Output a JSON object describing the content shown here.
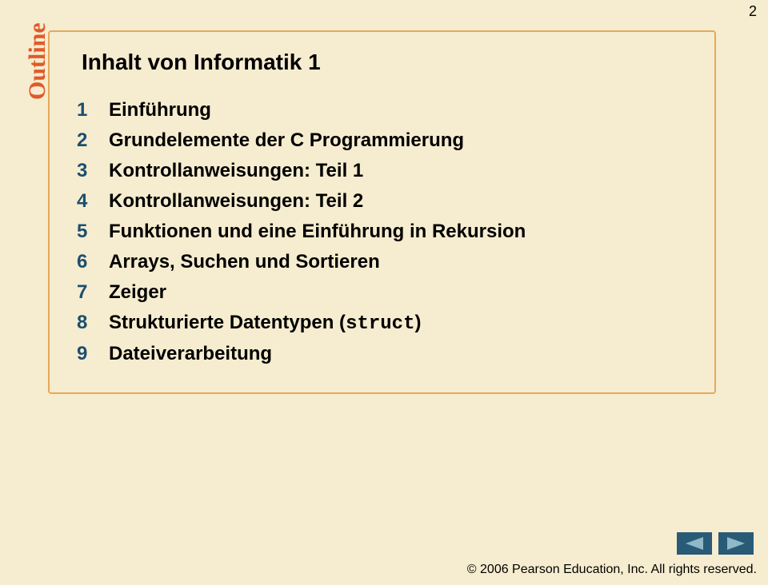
{
  "page_number": "2",
  "sidebar_label": "Outline",
  "title": "Inhalt von Informatik 1",
  "items": [
    {
      "num": "1",
      "text": "Einführung"
    },
    {
      "num": "2",
      "text": "Grundelemente der C Programmierung"
    },
    {
      "num": "3",
      "text": "Kontrollanweisungen: Teil 1"
    },
    {
      "num": "4",
      "text": "Kontrollanweisungen: Teil 2"
    },
    {
      "num": "5",
      "text": "Funktionen und eine Einführung in Rekursion"
    },
    {
      "num": "6",
      "text": "Arrays, Suchen und Sortieren"
    },
    {
      "num": "7",
      "text": "Zeiger"
    },
    {
      "num": "8",
      "text_prefix": "Strukturierte Datentypen (",
      "code": "struct",
      "text_suffix": ")"
    },
    {
      "num": "9",
      "text": "Dateiverarbeitung"
    }
  ],
  "footer": "© 2006 Pearson Education, Inc.  All rights reserved.",
  "nav": {
    "prev_icon": "prev-arrow-icon",
    "next_icon": "next-arrow-icon"
  },
  "colors": {
    "background": "#f6eccf",
    "border": "#e8a85a",
    "outline_label": "#e05a29",
    "number": "#1b4f6f",
    "nav": "#295b77"
  }
}
